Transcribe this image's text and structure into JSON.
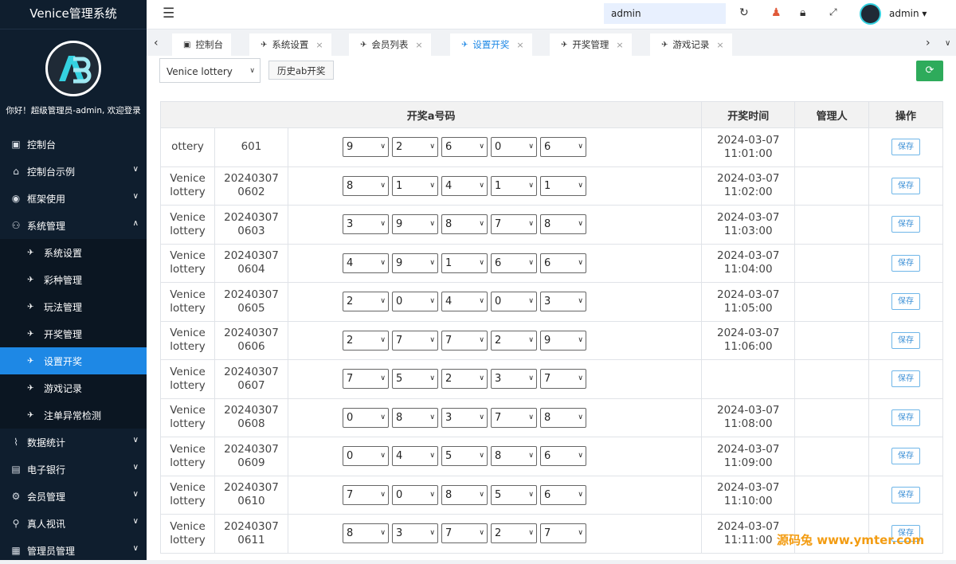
{
  "app": {
    "title": "Venice管理系统",
    "welcome": "你好！超级管理员-admin, 欢迎登录"
  },
  "sidebar": {
    "items": [
      {
        "label": "控制台",
        "icon": "monitor-icon",
        "glyph": "▣",
        "chevron": ""
      },
      {
        "label": "控制台示例",
        "icon": "home-icon",
        "glyph": "⌂",
        "chevron": "∨"
      },
      {
        "label": "框架使用",
        "icon": "ok-icon",
        "glyph": "◉",
        "chevron": "∨"
      },
      {
        "label": "系统管理",
        "icon": "user-icon",
        "glyph": "⚇",
        "chevron": "∧"
      }
    ],
    "subitems": [
      {
        "label": "系统设置",
        "active": false
      },
      {
        "label": "彩种管理",
        "active": false
      },
      {
        "label": "玩法管理",
        "active": false
      },
      {
        "label": "开奖管理",
        "active": false
      },
      {
        "label": "设置开奖",
        "active": true
      },
      {
        "label": "游戏记录",
        "active": false
      },
      {
        "label": "注单异常检测",
        "active": false
      }
    ],
    "bottom_items": [
      {
        "label": "数据统计",
        "icon": "chart-icon",
        "glyph": "⌇"
      },
      {
        "label": "电子银行",
        "icon": "bank-icon",
        "glyph": "▤"
      },
      {
        "label": "会员管理",
        "icon": "gear-icon",
        "glyph": "⚙"
      },
      {
        "label": "真人视讯",
        "icon": "bike-icon",
        "glyph": "⚲"
      },
      {
        "label": "管理员管理",
        "icon": "grid-icon",
        "glyph": "▦"
      }
    ]
  },
  "topbar": {
    "search_value": "admin",
    "username": "admin"
  },
  "tabs": [
    {
      "label": "控制台",
      "active": false,
      "closable": false
    },
    {
      "label": "系统设置",
      "active": false,
      "closable": true
    },
    {
      "label": "会员列表",
      "active": false,
      "closable": true
    },
    {
      "label": "设置开奖",
      "active": true,
      "closable": true
    },
    {
      "label": "开奖管理",
      "active": false,
      "closable": true
    },
    {
      "label": "游戏记录",
      "active": false,
      "closable": true
    }
  ],
  "toolbar": {
    "lottery_select": "Venice lottery",
    "history_button": "历史ab开奖"
  },
  "table": {
    "headers": [
      "开奖a号码",
      "开奖时间",
      "管理人",
      "操作"
    ],
    "save_label": "保存",
    "rows": [
      {
        "name": "ottery",
        "issue": "601",
        "nums": [
          "9",
          "2",
          "6",
          "0",
          "6"
        ],
        "time": "2024-03-07 11:01:00"
      },
      {
        "name": "Venice lottery",
        "issue": "202403070602",
        "nums": [
          "8",
          "1",
          "4",
          "1",
          "1"
        ],
        "time": "2024-03-07 11:02:00"
      },
      {
        "name": "Venice lottery",
        "issue": "202403070603",
        "nums": [
          "3",
          "9",
          "8",
          "7",
          "8"
        ],
        "time": "2024-03-07 11:03:00"
      },
      {
        "name": "Venice lottery",
        "issue": "202403070604",
        "nums": [
          "4",
          "9",
          "1",
          "6",
          "6"
        ],
        "time": "2024-03-07 11:04:00"
      },
      {
        "name": "Venice lottery",
        "issue": "202403070605",
        "nums": [
          "2",
          "0",
          "4",
          "0",
          "3"
        ],
        "time": "2024-03-07 11:05:00"
      },
      {
        "name": "Venice lottery",
        "issue": "202403070606",
        "nums": [
          "2",
          "7",
          "7",
          "2",
          "9"
        ],
        "time": "2024-03-07 11:06:00"
      },
      {
        "name": "Venice lottery",
        "issue": "202403070607",
        "nums": [
          "7",
          "5",
          "2",
          "3",
          "7"
        ],
        "time": ""
      },
      {
        "name": "Venice lottery",
        "issue": "202403070608",
        "nums": [
          "0",
          "8",
          "3",
          "7",
          "8"
        ],
        "time": "2024-03-07 11:08:00"
      },
      {
        "name": "Venice lottery",
        "issue": "202403070609",
        "nums": [
          "0",
          "4",
          "5",
          "8",
          "6"
        ],
        "time": "2024-03-07 11:09:00"
      },
      {
        "name": "Venice lottery",
        "issue": "202403070610",
        "nums": [
          "7",
          "0",
          "8",
          "5",
          "6"
        ],
        "time": "2024-03-07 11:10:00"
      },
      {
        "name": "Venice lottery",
        "issue": "202403070611",
        "nums": [
          "8",
          "3",
          "7",
          "2",
          "7"
        ],
        "time": "2024-03-07 11:11:00"
      }
    ]
  },
  "watermark": "源码兔 www.ymter.com"
}
